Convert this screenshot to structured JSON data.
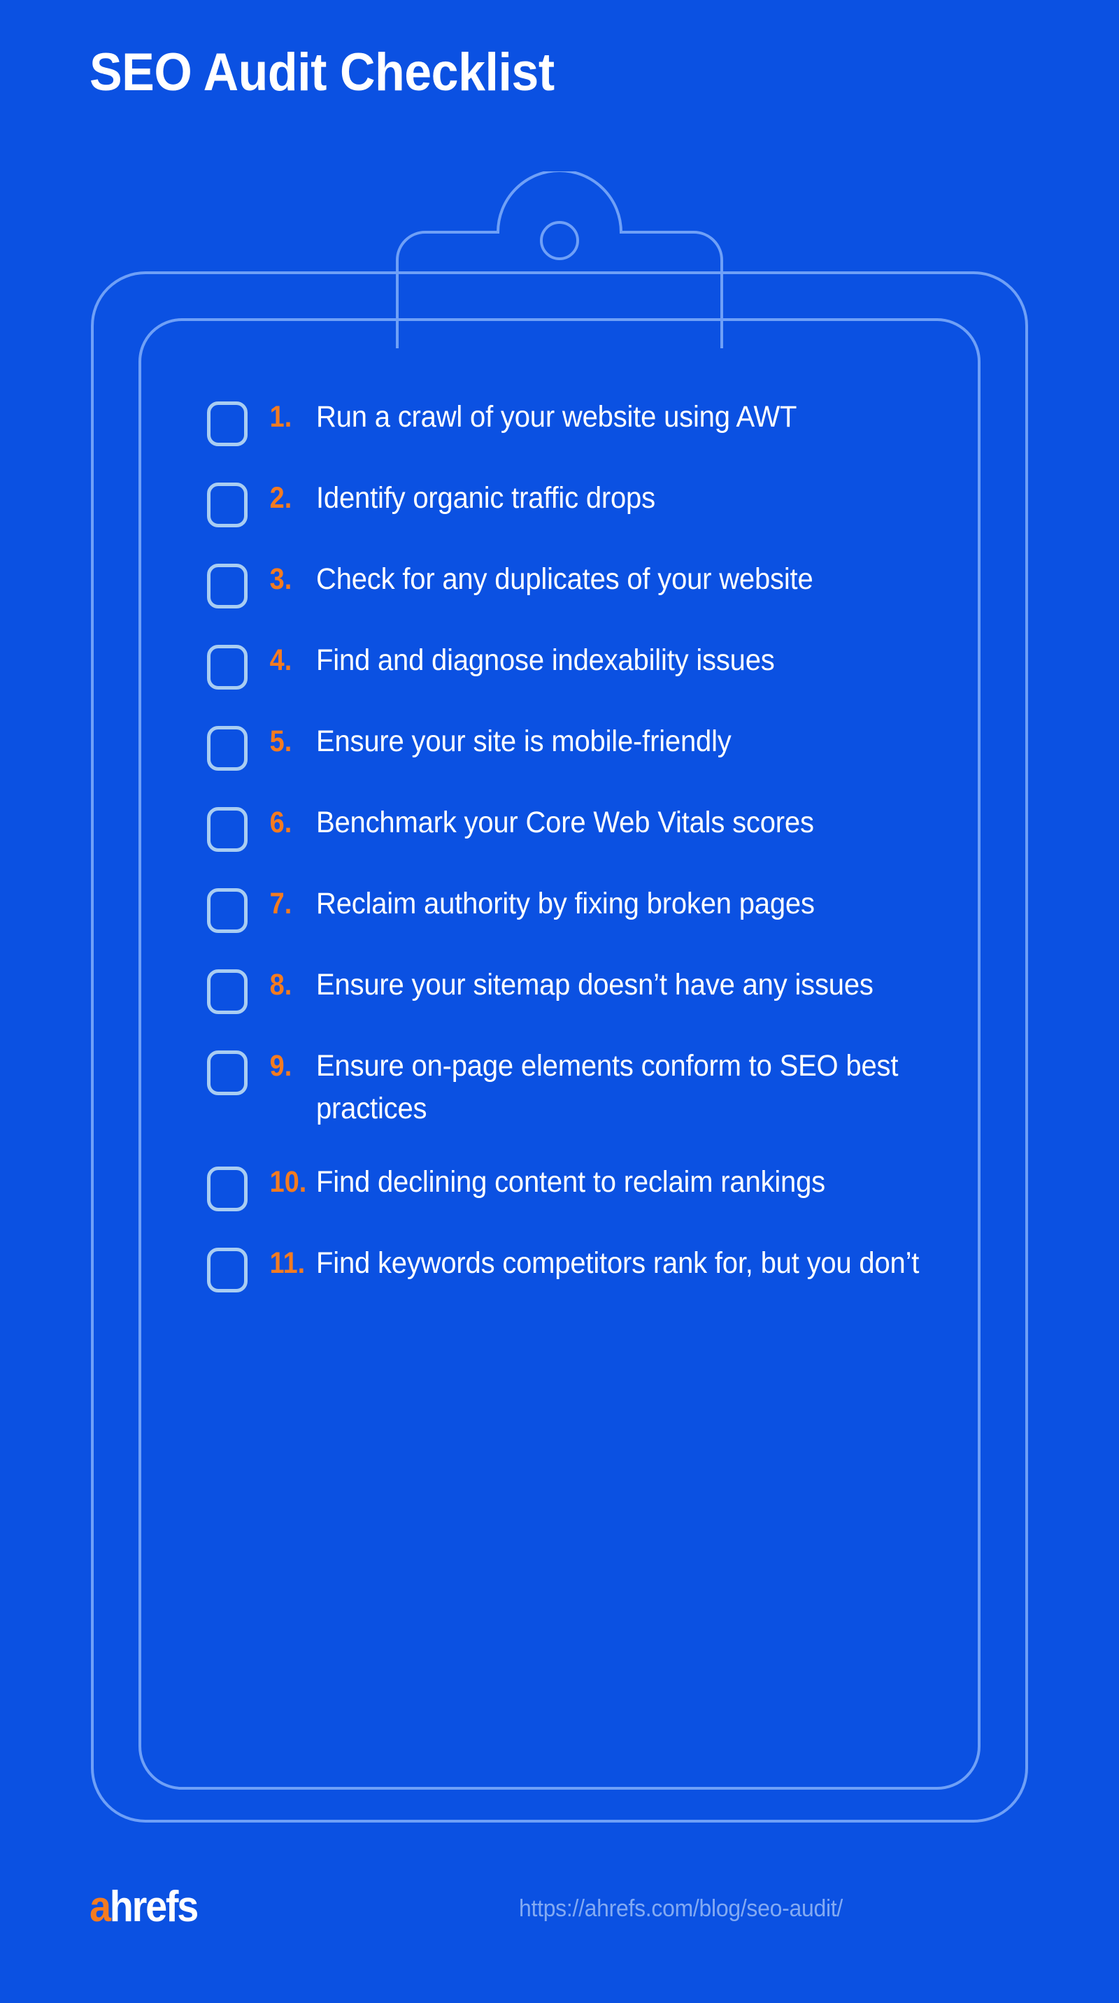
{
  "header": {
    "title": "SEO Audit Checklist"
  },
  "colors": {
    "background": "#0b51e2",
    "accent_orange": "#f47b20",
    "frame_blue": "#6fa0f7",
    "checkbox_blue": "#a9cdf2",
    "text_white": "#ffffff",
    "url_blue": "#83aaf2"
  },
  "clipboard": {
    "clip_icon": "clipboard-clip-icon",
    "hole_icon": "clip-hole-circle-icon"
  },
  "checklist": {
    "items": [
      {
        "number": "1.",
        "text": "Run a crawl of your website using AWT"
      },
      {
        "number": "2.",
        "text": "Identify organic traffic drops"
      },
      {
        "number": "3.",
        "text": "Check for any duplicates of your website"
      },
      {
        "number": "4.",
        "text": "Find and diagnose indexability issues"
      },
      {
        "number": "5.",
        "text": "Ensure your site is mobile-friendly"
      },
      {
        "number": "6.",
        "text": "Benchmark your Core Web Vitals scores"
      },
      {
        "number": "7.",
        "text": "Reclaim authority by fixing broken pages"
      },
      {
        "number": "8.",
        "text": "Ensure your sitemap doesn’t have any issues"
      },
      {
        "number": "9.",
        "text": "Ensure on-page elements conform to SEO best practices"
      },
      {
        "number": "10.",
        "text": "Find declining content to reclaim rankings"
      },
      {
        "number": "11.",
        "text": "Find keywords competitors rank for, but you don’t"
      }
    ]
  },
  "footer": {
    "logo_accent": "a",
    "logo_rest": "hrefs",
    "url": "https://ahrefs.com/blog/seo-audit/"
  }
}
